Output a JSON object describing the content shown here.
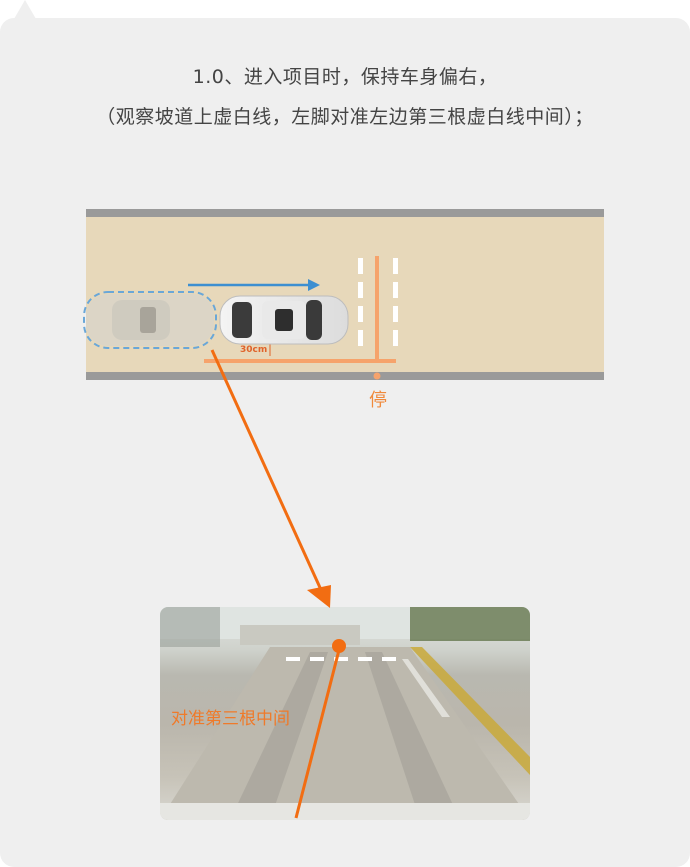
{
  "title_line1": "1.0、进入项目时，保持车身偏右，",
  "title_line2": "（观察坡道上虚白线，左脚对准左边第三根虚白线中间）；",
  "diagram": {
    "distance_label": "30cm",
    "stop_label": "停"
  },
  "photo": {
    "annotation": "对准第三根中间"
  },
  "colors": {
    "accent_orange": "#f26d12",
    "arrow_blue": "#3d8fd1",
    "road": "#e7d8ba",
    "road_edge": "#9a9a9a",
    "card_bg": "#efefef"
  }
}
